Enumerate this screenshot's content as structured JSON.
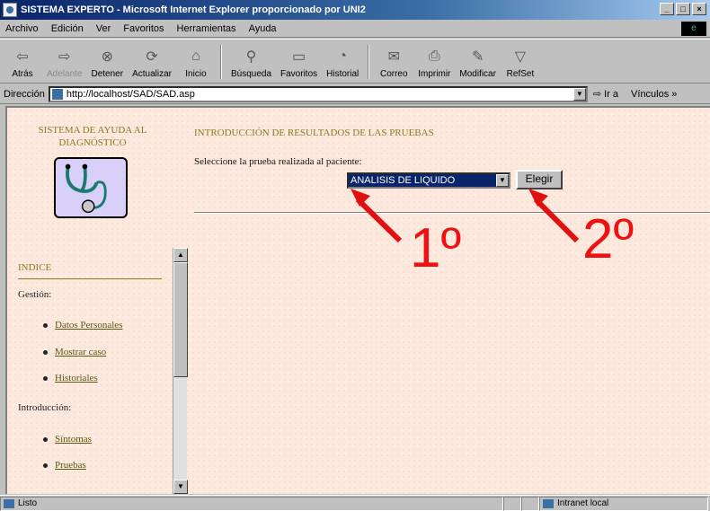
{
  "window": {
    "title": "SISTEMA EXPERTO - Microsoft Internet Explorer proporcionado por UNI2",
    "min": "_",
    "max": "□",
    "close": "×"
  },
  "menu": [
    "Archivo",
    "Edición",
    "Ver",
    "Favoritos",
    "Herramientas",
    "Ayuda"
  ],
  "toolbar": {
    "back": "Atrás",
    "forward": "Adelante",
    "stop": "Detener",
    "refresh": "Actualizar",
    "home": "Inicio",
    "search": "Búsqueda",
    "favorites": "Favoritos",
    "history": "Historial",
    "mail": "Correo",
    "print": "Imprimir",
    "edit": "Modificar",
    "refset": "RefSet"
  },
  "address": {
    "label": "Dirección",
    "url": "http://localhost/SAD/SAD.asp",
    "go": "Ir a",
    "links": "Vínculos »"
  },
  "sidebar": {
    "title": "SISTEMA DE AYUDA AL DIAGNÓSTICO",
    "index_title": "INDICE",
    "management_label": "Gestión:",
    "management_items": [
      "Datos Personales",
      "Mostrar caso",
      "Historiales"
    ],
    "intro_label": "Introducción:",
    "intro_items": [
      "Síntomas",
      "Pruebas"
    ]
  },
  "main": {
    "title": "INTRODUCCIÓN DE RESULTADOS DE LAS PRUEBAS",
    "prompt": "Seleccione la prueba realizada al paciente:",
    "selected_test": "ANALISIS DE LIQUIDO",
    "choose_button": "Elegir"
  },
  "annotations": {
    "first": "1º",
    "second": "2º",
    "color": "#e01010"
  },
  "status": {
    "text": "Listo",
    "zone": "Intranet local"
  }
}
